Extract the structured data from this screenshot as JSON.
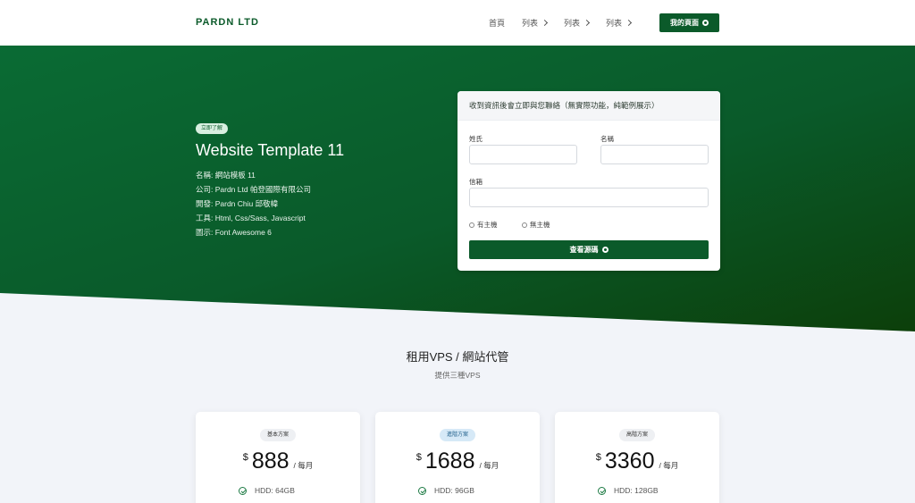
{
  "navbar": {
    "brand": "PARDN LTD",
    "items": [
      {
        "label": "首頁",
        "has_chevron": false
      },
      {
        "label": "列表",
        "has_chevron": true
      },
      {
        "label": "列表",
        "has_chevron": true
      },
      {
        "label": "列表",
        "has_chevron": true
      }
    ],
    "my_page_button": "我的頁面",
    "my_page_icon": "github-icon"
  },
  "hero": {
    "badge": "立即了解",
    "title": "Website Template 11",
    "info": [
      "名稱: 網站模板 11",
      "公司: Pardn Ltd 帕登國際有限公司",
      "開發: Pardn Chiu 邱敬幃",
      "工具: Html, Css/Sass, Javascript",
      "圖示: Font Awesome 6"
    ],
    "gradient_start": "#0a6b34",
    "gradient_end": "#0c3f0a"
  },
  "form": {
    "header": "收到資訊後會立即與您聯絡（無實際功能，純範例展示）",
    "surname_label": "姓氏",
    "name_label": "名稱",
    "email_label": "信箱",
    "radio_options": [
      "有主機",
      "無主機"
    ],
    "submit_label": "查看源碼",
    "submit_icon": "github-icon"
  },
  "section": {
    "title": "租用VPS / 網站代管",
    "subtitle": "提供三種VPS"
  },
  "plans": [
    {
      "badge": "基本方案",
      "currency": "$",
      "price": "888",
      "period": "/ 每月",
      "feature": "HDD: 64GB",
      "badge_style": "gray"
    },
    {
      "badge": "進階方案",
      "currency": "$",
      "price": "1688",
      "period": "/ 每月",
      "feature": "HDD: 96GB",
      "badge_style": "blue"
    },
    {
      "badge": "高階方案",
      "currency": "$",
      "price": "3360",
      "period": "/ 每月",
      "feature": "HDD: 128GB",
      "badge_style": "gray"
    }
  ],
  "colors": {
    "primary": "#0b5a2a",
    "page_bg": "#f2f4f9"
  }
}
